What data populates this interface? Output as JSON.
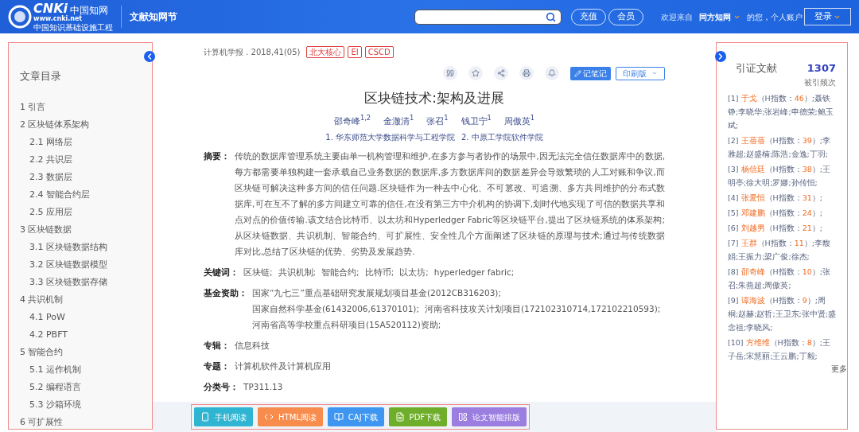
{
  "header": {
    "logo": {
      "mark": "CNKi",
      "cn": "中国知网",
      "url": "www.cnki.net",
      "tagline": "中国知识基础设施工程"
    },
    "site_title": "文献知网节",
    "buttons": [
      "充值",
      "会员"
    ],
    "welcome": "欢迎来自",
    "org": "同方知网",
    "account": "的您，个人账户",
    "login": "登录"
  },
  "toc": {
    "title": "文章目录",
    "items": [
      {
        "label": "1 引言"
      },
      {
        "label": "2 区块链体系架构",
        "children": [
          {
            "label": "2.1 网络层"
          },
          {
            "label": "2.2 共识层"
          },
          {
            "label": "2.3 数据层"
          },
          {
            "label": "2.4 智能合约层"
          },
          {
            "label": "2.5 应用层"
          }
        ]
      },
      {
        "label": "3 区块链数据",
        "children": [
          {
            "label": "3.1 区块链数据结构"
          },
          {
            "label": "3.2 区块链数据模型"
          },
          {
            "label": "3.3 区块链数据存储"
          }
        ]
      },
      {
        "label": "4 共识机制",
        "children": [
          {
            "label": "4.1 PoW"
          },
          {
            "label": "4.2 PBFT"
          }
        ]
      },
      {
        "label": "5 智能合约",
        "children": [
          {
            "label": "5.1 运作机制"
          },
          {
            "label": "5.2 编程语言"
          },
          {
            "label": "5.3 沙箱环境"
          }
        ]
      },
      {
        "label": "6 可扩展性"
      }
    ]
  },
  "article": {
    "source": "计算机学报 . 2018,41(05)",
    "tags": [
      "北大核心",
      "EI",
      "CSCD"
    ],
    "note_button": "记笔记",
    "print_button": "印刷版",
    "title": "区块链技术:架构及进展",
    "authors": [
      "邵奇峰$^{1,2}$",
      "金澈清$^{1}$",
      "张召$^{1}$",
      "钱卫宁$^{1}$",
      "周傲英$^{1}$"
    ],
    "affiliations": [
      "1. 华东师范大学数据科学与工程学院",
      "2. 中原工学院软件学院"
    ],
    "fields": [
      {
        "kind": "text",
        "label": "摘要：",
        "value": "传统的数据库管理系统主要由单一机构管理和维护,在多方参与者协作的场景中,因无法完全信任数据库中的数据,每方都需要单独构建一套承载自己业务数据的数据库,多方数据库间的数据差异会导致繁琐的人工对账和争议,而区块链可解决这种多方间的信任问题.区块链作为一种去中心化、不可篡改、可追溯、多方共同维护的分布式数据库,可在互不了解的多方间建立可靠的信任,在没有第三方中介机构的协调下,划时代地实现了可信的数据共享和点对点的价值传输.该文结合比特币、以太坊和Hyperledger Fabric等区块链平台,提出了区块链系统的体系架构;从区块链数据、共识机制、智能合约、可扩展性、安全性几个方面阐述了区块链的原理与技术;通过与传统数据库对比,总结了区块链的优势、劣势及发展趋势."
      },
      {
        "kind": "links",
        "label": "关键词：",
        "items": [
          "区块链;",
          "共识机制;",
          "智能合约;",
          "比特币;",
          "以太坊;",
          "hyperledger fabric;"
        ]
      },
      {
        "kind": "links",
        "label": "基金资助：",
        "items": [
          "国家“九七三”重点基础研究发展规划项目基金(2012CB316203);",
          "国家自然科学基金(61432006,61370101);",
          "河南省科技攻关计划项目(172102310714,172102210593);",
          "河南省高等学校重点科研项目(15A520112)资助;"
        ]
      },
      {
        "kind": "text",
        "label": "专辑：",
        "value": "信息科技"
      },
      {
        "kind": "text",
        "label": "专题：",
        "value": "计算机软件及计算机应用"
      },
      {
        "kind": "text",
        "label": "分类号：",
        "value": "TP311.13"
      }
    ],
    "actions": [
      {
        "kind": "phone",
        "label": "手机阅读"
      },
      {
        "kind": "html",
        "label": "HTML阅读"
      },
      {
        "kind": "caj",
        "label": "CAJ下载"
      },
      {
        "kind": "pdf",
        "label": "PDF下载"
      },
      {
        "kind": "layout",
        "label": "论文智能排版"
      }
    ]
  },
  "citations": {
    "title": "引证文献",
    "count": "1307",
    "count_label": "被引频次",
    "more": "更多",
    "items": [
      {
        "index": "[1]",
        "author": "于戈",
        "h_prefix": "（H指数：",
        "h_value": "46",
        "h_suffix": "）",
        "coauthors": ";聂铁铮;李晓华;张岩峰;申德荣;鲍玉斌;"
      },
      {
        "index": "[2]",
        "author": "王蓓蓓",
        "h_prefix": "（H指数：",
        "h_value": "39",
        "h_suffix": "）",
        "coauthors": ";李雅超;赵盛楠;陈浩;金逸;丁羽;"
      },
      {
        "index": "[3]",
        "author": "杨信廷",
        "h_prefix": "（H指数：",
        "h_value": "38",
        "h_suffix": "）",
        "coauthors": ";王明亭;徐大明;罗娜;孙传恒;"
      },
      {
        "index": "[4]",
        "author": "张爱恒",
        "h_prefix": "（H指数：",
        "h_value": "31",
        "h_suffix": "）;"
      },
      {
        "index": "[5]",
        "author": "邓建鹏",
        "h_prefix": "（H指数：",
        "h_value": "24",
        "h_suffix": "）;"
      },
      {
        "index": "[6]",
        "author": "刘越男",
        "h_prefix": "（H指数：",
        "h_value": "21",
        "h_suffix": "）;"
      },
      {
        "index": "[7]",
        "author": "王群",
        "h_prefix": "（H指数：",
        "h_value": "11",
        "h_suffix": "）",
        "coauthors": ";李馥娟;王振力;梁广俊;徐杰;"
      },
      {
        "index": "[8]",
        "author": "邵奇峰",
        "h_prefix": "（H指数：",
        "h_value": "10",
        "h_suffix": "）",
        "coauthors": ";张召;朱燕超;周傲英;"
      },
      {
        "index": "[9]",
        "author": "谭海波",
        "h_prefix": "（H指数：",
        "h_value": "9",
        "h_suffix": "）",
        "coauthors": ";周桐;赵赫;赵哲;王卫东;张中贤;盛念祖;李晓风;"
      },
      {
        "index": "[10]",
        "author": "方维维",
        "h_prefix": "（H指数：",
        "h_value": "8",
        "h_suffix": "）",
        "coauthors": ";王子岳;宋慧丽;王云鹏;丁毅;"
      }
    ]
  }
}
